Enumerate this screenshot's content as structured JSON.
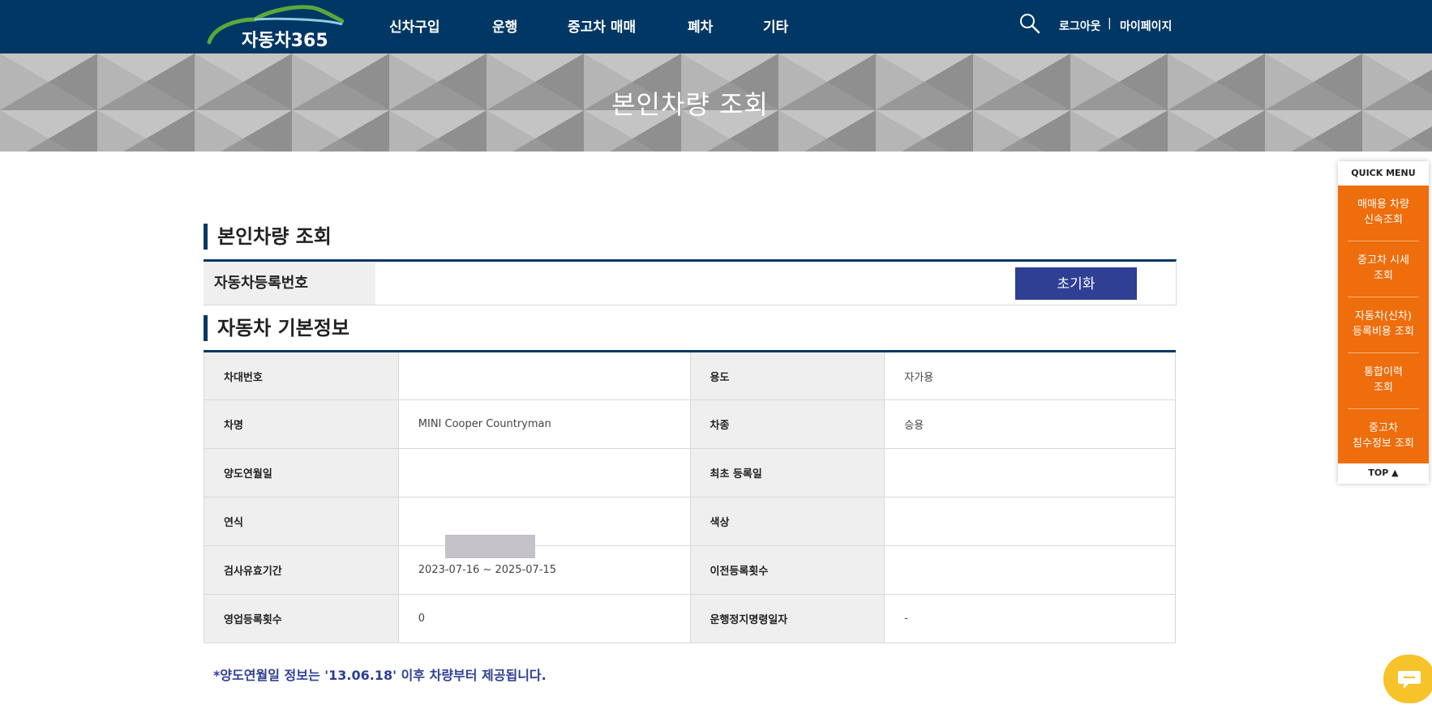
{
  "header": {
    "logo_text": "자동차365",
    "nav": [
      "신차구입",
      "운행",
      "중고차 매매",
      "폐차",
      "기타"
    ],
    "logout": "로그아웃",
    "separator": "|",
    "mypage": "마이페이지"
  },
  "banner": {
    "title": "본인차량 조회"
  },
  "section1": {
    "title": "본인차량 조회",
    "reg_label": "자동차등록번호",
    "reset_button": "초기화"
  },
  "section2": {
    "title": "자동차 기본정보",
    "rows": [
      {
        "label1": "차대번호",
        "value1": "",
        "label2": "용도",
        "value2": "자가용"
      },
      {
        "label1": "차명",
        "value1": "MINI Cooper Countryman",
        "label2": "차종",
        "value2": "승용"
      },
      {
        "label1": "양도연월일",
        "value1": "",
        "label2": "최초 등록일",
        "value2": ""
      },
      {
        "label1": "연식",
        "value1": "",
        "label2": "색상",
        "value2": ""
      },
      {
        "label1": "검사유효기간",
        "value1": "2023-07-16 ~ 2025-07-15",
        "label2": "이전등록횟수",
        "value2": ""
      },
      {
        "label1": "영업등록횟수",
        "value1": "0",
        "label2": "운행정지명령일자",
        "value2": "-"
      }
    ],
    "note": "*양도연월일 정보는 '13.06.18' 이후 차량부터 제공됩니다."
  },
  "quick_menu": {
    "title": "QUICK MENU",
    "items": [
      {
        "line1": "매매용 차량",
        "line2": "신속조회"
      },
      {
        "line1": "중고차 시세",
        "line2": "조회"
      },
      {
        "line1": "자동차(신차)",
        "line2": "등록비용 조회"
      },
      {
        "line1": "통합이력",
        "line2": "조회"
      },
      {
        "line1": "중고차",
        "line2": "침수정보 조회"
      }
    ],
    "top": "TOP ▲"
  },
  "colors": {
    "header_bg": "#003764",
    "accent_orange": "#ee6d0c",
    "button_blue": "#2e3f94",
    "chat_yellow": "#f7c32a"
  }
}
